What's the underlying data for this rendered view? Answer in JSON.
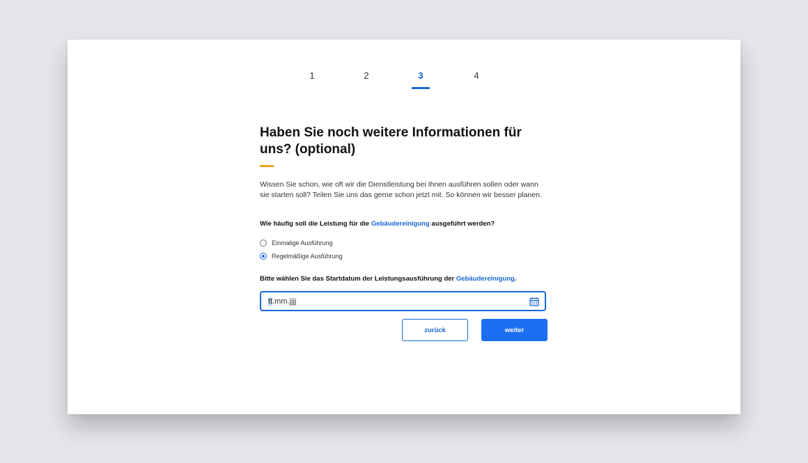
{
  "stepper": {
    "steps": [
      {
        "label": "1"
      },
      {
        "label": "2"
      },
      {
        "label": "3",
        "active": true
      },
      {
        "label": "4"
      }
    ]
  },
  "form": {
    "title": "Haben Sie noch weitere Informationen für uns? (optional)",
    "intro": "Wissen Sie schon, wie oft wir die Dienstleistung bei Ihnen ausführen sollen oder wann sie starten soll? Teilen Sie uns das gerne schon jetzt mit. So können wir besser planen.",
    "frequency_question": {
      "prefix": "Wie häufig soll die Leistung für die ",
      "link": "Gebäudereinigung",
      "suffix": " ausgeführt werden?"
    },
    "frequency_options": [
      {
        "label": "Einmalige Ausführung",
        "checked": false
      },
      {
        "label": "Regelmäßige Ausführung",
        "checked": true
      }
    ],
    "date_question": {
      "prefix": "Bitte wählen Sie das Startdatum der Leistungsausführung der ",
      "link": "Gebäudereinigung",
      "suffix": "."
    },
    "date_field": {
      "selected_part": "tt",
      "rest": ".mm.jjjj",
      "icon": "calendar-icon"
    },
    "buttons": {
      "back_label": "zurück",
      "next_label": "weiter"
    }
  },
  "colors": {
    "primary": "#1766d6",
    "accent": "#f2a31b",
    "background": "#e5e6ea"
  }
}
